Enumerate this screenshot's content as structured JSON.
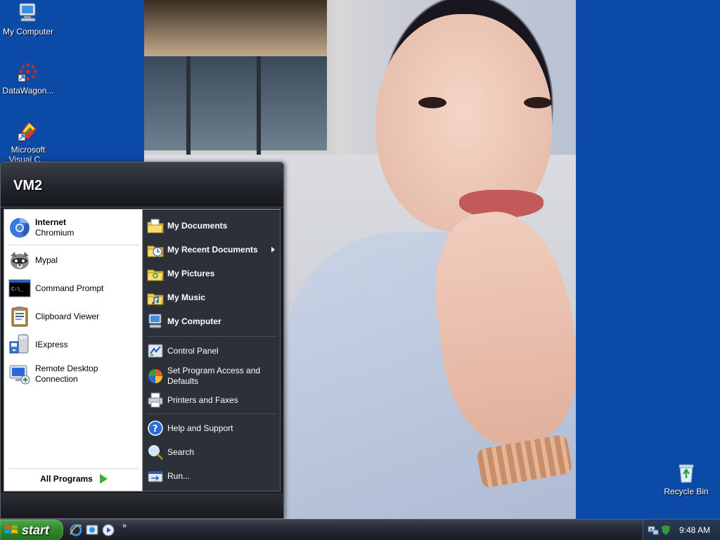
{
  "desktop": {
    "icons": [
      {
        "label": "My Computer",
        "icon": "my-computer-icon"
      },
      {
        "label": "DataWagon...",
        "icon": "datawagon-icon"
      },
      {
        "label": "Microsoft Visual C...",
        "icon": "visual-c-icon"
      },
      {
        "label": "Recycle Bin",
        "icon": "recycle-bin-icon"
      }
    ],
    "background_color": "#0b4aa6"
  },
  "start_menu": {
    "user_name": "VM2",
    "pinned": [
      {
        "title": "Internet",
        "subtitle": "Chromium",
        "icon": "chromium-icon"
      }
    ],
    "recent_programs": [
      {
        "label": "Mypal",
        "icon": "mypal-icon"
      },
      {
        "label": "Command Prompt",
        "icon": "command-prompt-icon"
      },
      {
        "label": "Clipboard Viewer",
        "icon": "clipboard-viewer-icon"
      },
      {
        "label": "IExpress",
        "icon": "iexpress-icon"
      },
      {
        "label": "Remote Desktop Connection",
        "icon": "remote-desktop-icon"
      }
    ],
    "all_programs_label": "All Programs",
    "places": [
      {
        "label": "My Documents",
        "icon": "my-documents-icon"
      },
      {
        "label": "My Recent Documents",
        "icon": "recent-documents-icon"
      },
      {
        "label": "My Pictures",
        "icon": "my-pictures-icon"
      },
      {
        "label": "My Music",
        "icon": "my-music-icon"
      },
      {
        "label": "My Computer",
        "icon": "my-computer-icon"
      }
    ],
    "settings": [
      {
        "label": "Control Panel",
        "icon": "control-panel-icon"
      },
      {
        "label": "Set Program Access and Defaults",
        "icon": "program-access-icon"
      },
      {
        "label": "Printers and Faxes",
        "icon": "printers-icon"
      }
    ],
    "help": [
      {
        "label": "Help and Support",
        "icon": "help-icon"
      },
      {
        "label": "Search",
        "icon": "search-icon"
      },
      {
        "label": "Run...",
        "icon": "run-icon"
      }
    ]
  },
  "taskbar": {
    "start_label": "start",
    "quick_launch_more": "»",
    "clock": "9:48 AM"
  }
}
